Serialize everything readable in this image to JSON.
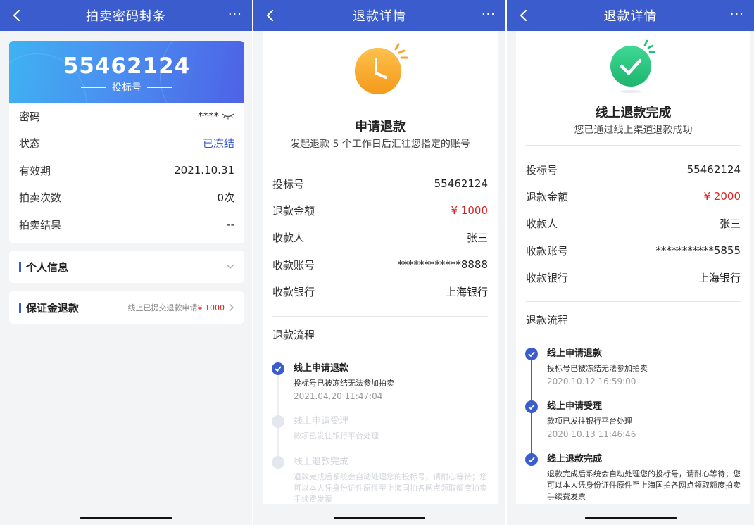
{
  "screen1": {
    "nav": {
      "title": "拍卖密码封条",
      "more": "···"
    },
    "bid": {
      "number": "55462124",
      "label": "投标号"
    },
    "rows": [
      {
        "key": "密码",
        "value": "****"
      },
      {
        "key": "状态",
        "value": "已冻结"
      },
      {
        "key": "有效期",
        "value": "2021.10.31"
      },
      {
        "key": "拍卖次数",
        "value": "0次"
      },
      {
        "key": "拍卖结果",
        "value": "--"
      }
    ],
    "personal": {
      "label": "个人信息"
    },
    "deposit": {
      "label": "保证金退款",
      "hint": "线上已提交退款申请",
      "amount": "¥ 1000"
    }
  },
  "screen2": {
    "nav": {
      "title": "退款详情",
      "more": "···"
    },
    "status": {
      "title": "申请退款",
      "desc": "发起退款 5 个工作日后汇往您指定的账号"
    },
    "rows": [
      {
        "key": "投标号",
        "value": "55462124"
      },
      {
        "key": "退款金额",
        "value": "¥ 1000"
      },
      {
        "key": "收款人",
        "value": "张三"
      },
      {
        "key": "收款账号",
        "value": "************8888"
      },
      {
        "key": "收款银行",
        "value": "上海银行"
      }
    ],
    "flow_title": "退款流程",
    "steps": [
      {
        "name": "线上申请退款",
        "desc": "投标号已被冻结无法参加拍卖",
        "time": "2021.04.20 11:47:04"
      },
      {
        "name": "线上申请受理",
        "desc": "款项已发往银行平台处理"
      },
      {
        "name": "线上退款完成",
        "desc": "退款完成后系统会自动处理您的投标号，请耐心等待；您可以本人凭身份证件原件至上海国拍各网点领取额度拍卖手续费发票"
      }
    ]
  },
  "screen3": {
    "nav": {
      "title": "退款详情",
      "more": "···"
    },
    "status": {
      "title": "线上退款完成",
      "desc": "您已通过线上渠道退款成功"
    },
    "rows": [
      {
        "key": "投标号",
        "value": "55462124"
      },
      {
        "key": "退款金额",
        "value": "¥ 2000"
      },
      {
        "key": "收款人",
        "value": "张三"
      },
      {
        "key": "收款账号",
        "value": "***********5855"
      },
      {
        "key": "收款银行",
        "value": "上海银行"
      }
    ],
    "flow_title": "退款流程",
    "steps": [
      {
        "name": "线上申请退款",
        "desc": "投标号已被冻结无法参加拍卖",
        "time": "2020.10.12 16:59:00"
      },
      {
        "name": "线上申请受理",
        "desc": "款项已发往银行平台处理",
        "time": "2020.10.13 11:46:46"
      },
      {
        "name": "线上退款完成",
        "desc": "退款完成后系统会自动处理您的投标号，请耐心等待；您可以本人凭身份证件原件至上海国拍各网点领取额度拍卖手续费发票"
      }
    ]
  },
  "colors": {
    "primary": "#3b5ccc",
    "red": "#e02020",
    "orange": "#f5a623",
    "green": "#22c07a"
  }
}
